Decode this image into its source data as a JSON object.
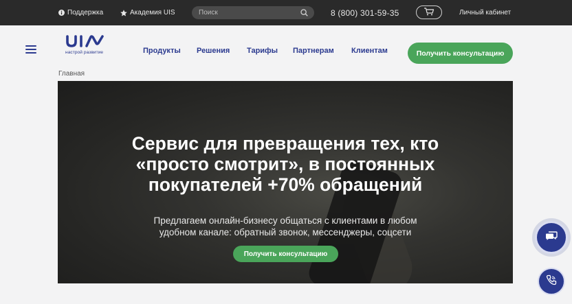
{
  "topbar": {
    "support": "Поддержка",
    "academy": "Академия UIS",
    "search_placeholder": "Поиск",
    "phone": "8 (800) 301-59-35",
    "cabinet": "Личный кабинет"
  },
  "header": {
    "logo_tagline": "настрой развитие",
    "nav": [
      "Продукты",
      "Решения",
      "Тарифы",
      "Партнерам",
      "Клиентам"
    ],
    "consult_label": "Получить консультацию"
  },
  "breadcrumb": "Главная",
  "hero": {
    "title_lines": [
      "Сервис для превращения тех, кто",
      "«просто смотрит», в постоянных",
      "покупателей +70% обращений"
    ],
    "subtitle_lines": [
      "Предлагаем онлайн-бизнесу общаться с клиентами в любом",
      "удобном канале: обратный звонок, мессенджеры, соцсети"
    ],
    "button_label": "Получить консультацию"
  },
  "icons": {
    "support": "info-icon",
    "academy": "star-icon",
    "search": "search-icon",
    "cart": "cart-icon",
    "chat": "chat-icon",
    "call": "phone-icon"
  },
  "colors": {
    "topbar_bg": "#2a2a2a",
    "brand_blue": "#2b3a8f",
    "accent_green": "#4aa55a"
  }
}
